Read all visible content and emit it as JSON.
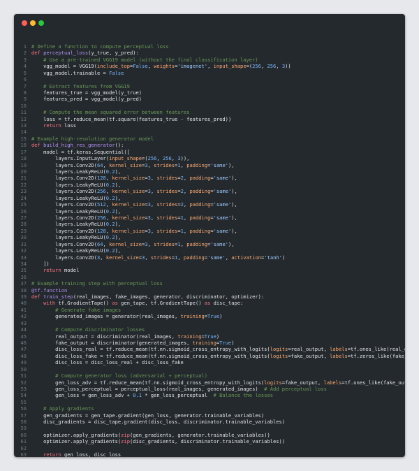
{
  "window": {
    "controls": [
      {
        "name": "close",
        "color": "#ff5f57"
      },
      {
        "name": "minimize",
        "color": "#febc2e"
      },
      {
        "name": "maximize",
        "color": "#28c840"
      }
    ]
  },
  "editor": {
    "lines": [
      "# Define a function to compute perceptual loss",
      "def perceptual_loss(y_true, y_pred):",
      "    # Use a pre-trained VGG19 model (without the final classification layer)",
      "    vgg_model = VGG19(include_top=False, weights='imagenet', input_shape=(256, 256, 3))",
      "    vgg_model.trainable = False",
      "",
      "    # Extract features from VGG19",
      "    features_true = vgg_model(y_true)",
      "    features_pred = vgg_model(y_pred)",
      "",
      "    # Compute the mean squared error between features",
      "    loss = tf.reduce_mean(tf.square(features_true - features_pred))",
      "    return loss",
      "",
      "# Example high-resolution generator model",
      "def build_high_res_generator():",
      "    model = tf.keras.Sequential([",
      "        layers.InputLayer(input_shape=(256, 256, 3)),",
      "        layers.Conv2D(64, kernel_size=3, strides=1, padding='same'),",
      "        layers.LeakyReLU(0.2),",
      "        layers.Conv2D(128, kernel_size=3, strides=2, padding='same'),",
      "        layers.LeakyReLU(0.2),",
      "        layers.Conv2D(256, kernel_size=3, strides=2, padding='same'),",
      "        layers.LeakyReLU(0.2),",
      "        layers.Conv2D(512, kernel_size=3, strides=2, padding='same'),",
      "        layers.LeakyReLU(0.2),",
      "        layers.Conv2D(256, kernel_size=3, strides=1, padding='same'),",
      "        layers.LeakyReLU(0.2),",
      "        layers.Conv2D(128, kernel_size=3, strides=1, padding='same'),",
      "        layers.LeakyReLU(0.2),",
      "        layers.Conv2D(64, kernel_size=3, strides=1, padding='same'),",
      "        layers.LeakyReLU(0.2),",
      "        layers.Conv2D(3, kernel_size=3, strides=1, padding='same', activation='tanh')",
      "    ])",
      "    return model",
      "",
      "# Example training step with perceptual loss",
      "@tf.function",
      "def train_step(real_images, fake_images, generator, discriminator, optimizer):",
      "    with tf.GradientTape() as gen_tape, tf.GradientTape() as disc_tape:",
      "        # Generate fake images",
      "        generated_images = generator(real_images, training=True)",
      "",
      "        # Compute discriminator losses",
      "        real_output = discriminator(real_images, training=True)",
      "        fake_output = discriminator(generated_images, training=True)",
      "        disc_loss_real = tf.reduce_mean(tf.nn.sigmoid_cross_entropy_with_logits(logits=real_output, labels=tf.ones_like(real_output)))",
      "        disc_loss_fake = tf.reduce_mean(tf.nn.sigmoid_cross_entropy_with_logits(logits=fake_output, labels=tf.zeros_like(fake_output)))",
      "        disc_loss = disc_loss_real + disc_loss_fake",
      "",
      "        # Compute generator loss (adversarial + perceptual)",
      "        gen_loss_adv = tf.reduce_mean(tf.nn.sigmoid_cross_entropy_with_logits(logits=fake_output, labels=tf.ones_like(fake_output)))",
      "        gen_loss_perceptual = perceptual_loss(real_images, generated_images)  # Add perceptual loss",
      "        gen_loss = gen_loss_adv + 0.1 * gen_loss_perceptual  # Balance the losses",
      "",
      "    # Apply gradients",
      "    gen_gradients = gen_tape.gradient(gen_loss, generator.trainable_variables)",
      "    disc_gradients = disc_tape.gradient(disc_loss, discriminator.trainable_variables)",
      "",
      "    optimizer.apply_gradients(zip(gen_gradients, generator.trainable_variables))",
      "    optimizer.apply_gradients(zip(disc_gradients, discriminator.trainable_variables))",
      "",
      "    return gen_loss, disc_loss"
    ]
  }
}
